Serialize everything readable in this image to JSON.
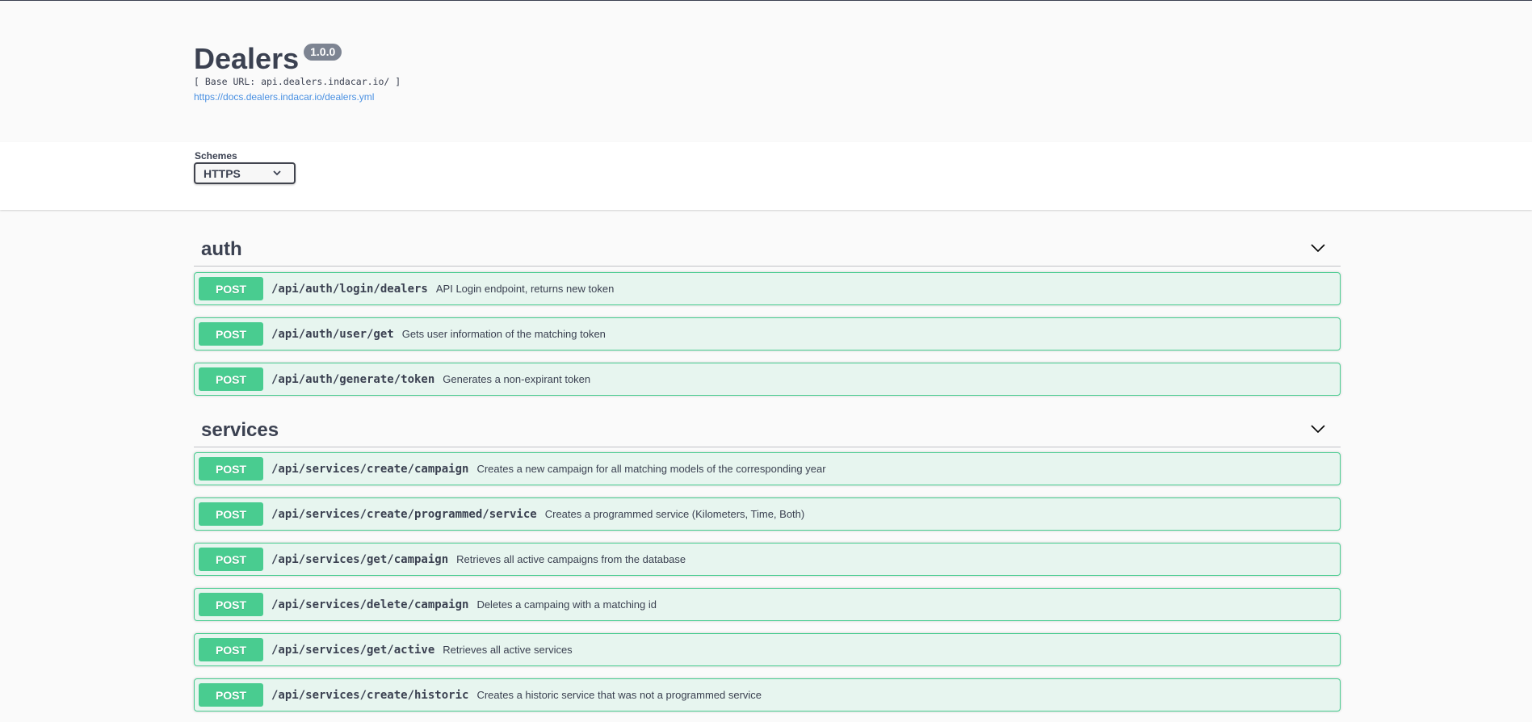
{
  "info": {
    "title": "Dealers",
    "version": "1.0.0",
    "base_url": "[ Base URL: api.dealers.indacar.io/ ]",
    "spec_link": "https://docs.dealers.indacar.io/dealers.yml"
  },
  "schemes": {
    "label": "Schemes",
    "selected": "HTTPS"
  },
  "colors": {
    "post": "#49cc90",
    "link": "#4990e2",
    "version_badge": "#7d8492"
  },
  "tags": [
    {
      "name": "auth",
      "toggle_icon": "chevron-down-icon",
      "operations": [
        {
          "method": "POST",
          "path": "/api/auth/login/dealers",
          "summary": "API Login endpoint, returns new token"
        },
        {
          "method": "POST",
          "path": "/api/auth/user/get",
          "summary": "Gets user information of the matching token"
        },
        {
          "method": "POST",
          "path": "/api/auth/generate/token",
          "summary": "Generates a non-expirant token"
        }
      ]
    },
    {
      "name": "services",
      "toggle_icon": "chevron-down-icon",
      "operations": [
        {
          "method": "POST",
          "path": "/api/services/create/campaign",
          "summary": "Creates a new campaign for all matching models of the corresponding year"
        },
        {
          "method": "POST",
          "path": "/api/services/create/programmed/service",
          "summary": "Creates a programmed service (Kilometers, Time, Both)"
        },
        {
          "method": "POST",
          "path": "/api/services/get/campaign",
          "summary": "Retrieves all active campaigns from the database"
        },
        {
          "method": "POST",
          "path": "/api/services/delete/campaign",
          "summary": "Deletes a campaing with a matching id"
        },
        {
          "method": "POST",
          "path": "/api/services/get/active",
          "summary": "Retrieves all active services"
        },
        {
          "method": "POST",
          "path": "/api/services/create/historic",
          "summary": "Creates a historic service that was not a programmed service"
        }
      ]
    }
  ]
}
